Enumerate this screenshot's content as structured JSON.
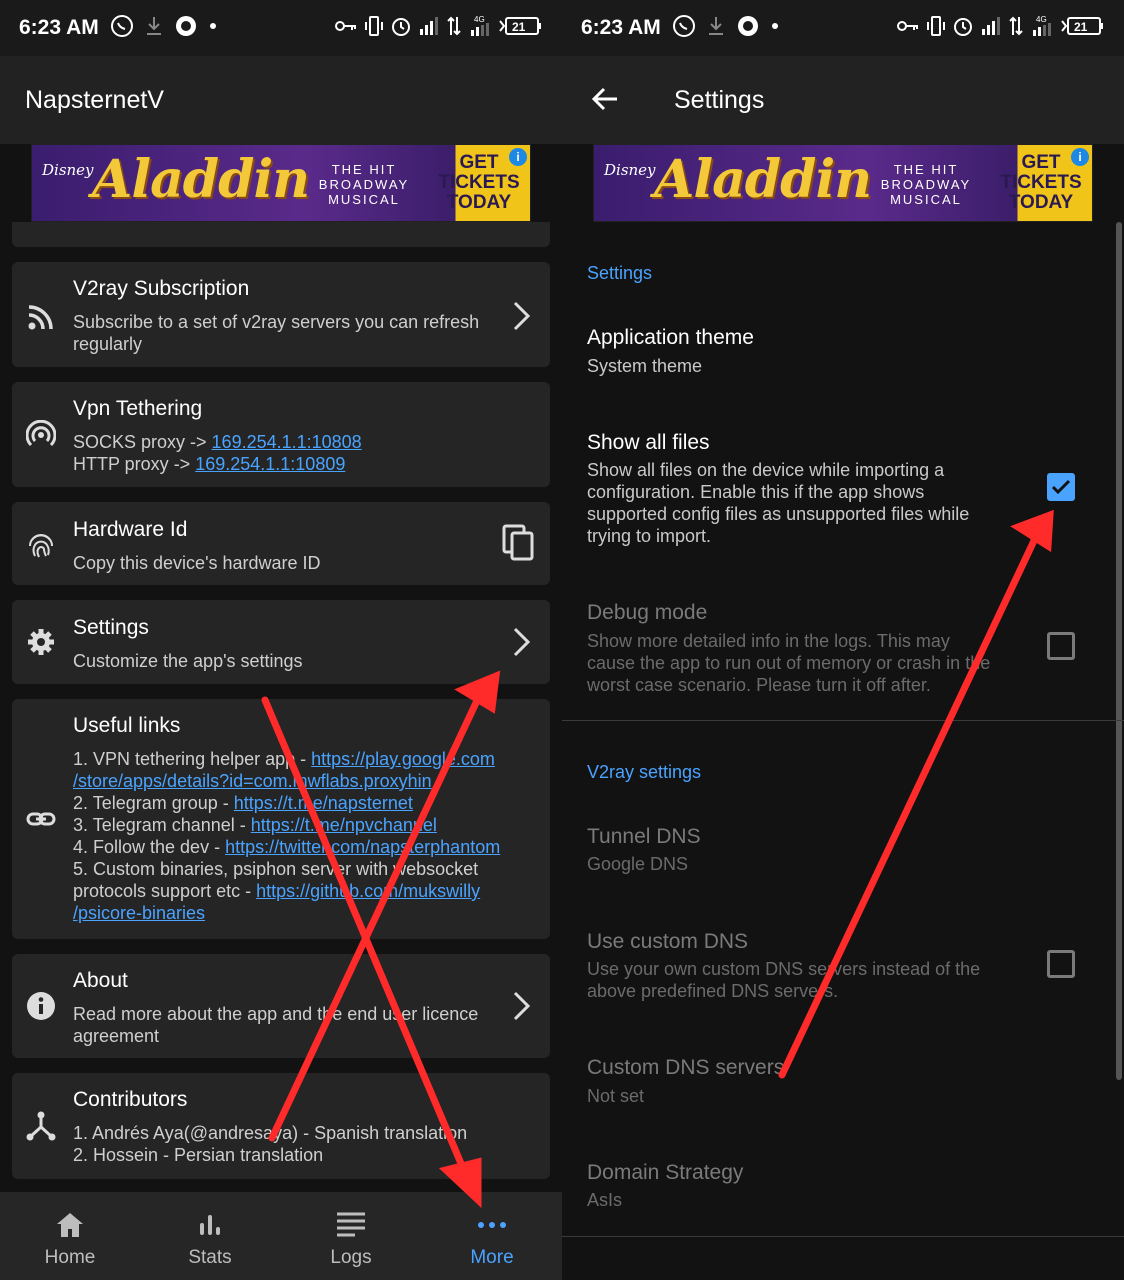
{
  "status_bar": {
    "time": "6:23 AM",
    "battery": "21",
    "network": "4G"
  },
  "left": {
    "app_title": "NapsternetV",
    "ad": {
      "brand": "Disney",
      "title": "Aladdin",
      "subtitle": "THE HIT\nBROADWAY\nMUSICAL",
      "cta": "GET\nTICKETS\nTODAY",
      "info": "i"
    },
    "cards": {
      "subscription": {
        "title": "V2ray Subscription",
        "desc": "Subscribe to a set of v2ray servers you can refresh regularly"
      },
      "tethering": {
        "title": "Vpn Tethering",
        "socks_label": "SOCKS proxy -> ",
        "socks_value": "169.254.1.1:10808",
        "http_label": "HTTP proxy -> ",
        "http_value": "169.254.1.1:10809"
      },
      "hardware": {
        "title": "Hardware Id",
        "desc": "Copy this device's hardware ID"
      },
      "settings": {
        "title": "Settings",
        "desc": "Customize the app's settings"
      },
      "links": {
        "title": "Useful links",
        "items": [
          {
            "prefix": "1. VPN tethering helper app - ",
            "url_1": "https://play.google.com",
            "url_2": "/store/apps/details?id=com.mwflabs.proxyhin"
          },
          {
            "prefix": "2. Telegram group - ",
            "url_1": "https://t.me/napsternet"
          },
          {
            "prefix": "3. Telegram channel - ",
            "url_1": "https://t.me/npvchannel"
          },
          {
            "prefix": "4. Follow the dev - ",
            "url_1": "https://twitter.com/napsterphantom"
          },
          {
            "prefix": "5. Custom binaries, psiphon server with websocket",
            "prefix_2": "protocols support etc - ",
            "url_1": "https://github.com/mukswilly",
            "url_2": "/psicore-binaries"
          }
        ]
      },
      "about": {
        "title": "About",
        "desc": "Read more about the app and the end user licence agreement"
      },
      "contributors": {
        "title": "Contributors",
        "line_1": "1. Andrés Aya(@andresaya) - Spanish translation",
        "line_2": "2. Hossein - Persian translation"
      }
    },
    "bottom_nav": [
      {
        "label": "Home",
        "icon": "home-icon",
        "active": false
      },
      {
        "label": "Stats",
        "icon": "stats-icon",
        "active": false
      },
      {
        "label": "Logs",
        "icon": "logs-icon",
        "active": false
      },
      {
        "label": "More",
        "icon": "more-icon",
        "active": true
      }
    ]
  },
  "right": {
    "app_title": "Settings",
    "group_1": "Settings",
    "app_theme": {
      "title": "Application theme",
      "value": "System theme"
    },
    "show_all_files": {
      "title": "Show all files",
      "desc": "Show all files on the device while importing a configuration. Enable this if the app shows supported config files as unsupported files while trying to import.",
      "checked": true
    },
    "debug_mode": {
      "title": "Debug mode",
      "desc": "Show more detailed info in the logs. This may cause the app to run out of memory or crash in the worst case scenario. Please turn it off after.",
      "checked": false
    },
    "group_2": "V2ray settings",
    "tunnel_dns": {
      "title": "Tunnel DNS",
      "value": "Google DNS"
    },
    "custom_dns": {
      "title": "Use custom DNS",
      "desc": "Use your own custom DNS servers instead of the above predefined DNS servers.",
      "checked": false
    },
    "custom_dns_servers": {
      "title": "Custom DNS servers",
      "value": "Not set"
    },
    "domain_strategy": {
      "title": "Domain Strategy",
      "value": "AsIs"
    }
  },
  "colors": {
    "accent": "#4aa3ff",
    "annotation": "#ff2a2a",
    "card": "#252525",
    "background": "#121212"
  }
}
